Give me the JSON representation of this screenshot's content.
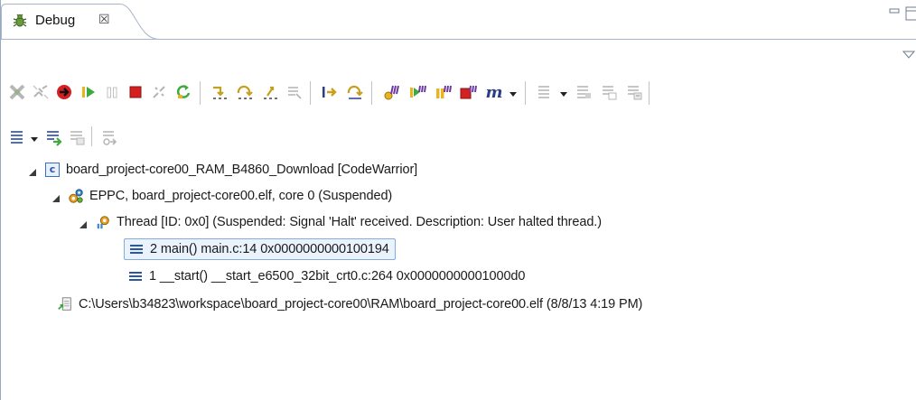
{
  "view": {
    "tab_label": "Debug",
    "tab_close_glyph": "☒",
    "tab_icon": "bug-icon"
  },
  "toolbar1": {
    "buttons": [
      "remove-all-terminated-icon",
      "connect-icon",
      "debug-step-into-icon",
      "resume-icon",
      "suspend-icon",
      "terminate-icon",
      "disconnect-icon",
      "restart-icon",
      "step-into-icon",
      "step-over-icon",
      "step-return-icon",
      "drop-to-frame-icon",
      "instruction-stepping-icon",
      "use-step-filters-icon",
      "multicore-group-icon",
      "multicore-resume-icon",
      "multicore-suspend-icon",
      "multicore-terminate-icon",
      "multicore-m-icon",
      "dropdown-arrow-icon",
      "collapse-all-icon",
      "dropdown-arrow-icon",
      "source-lookup-icon",
      "disassembly-icon",
      "memory-icon"
    ],
    "m_glyph": "m"
  },
  "toolbar2": {
    "buttons": [
      "layout-icon",
      "dropdown-arrow-icon",
      "move-icon",
      "copy-stack-icon",
      "filter-icon"
    ]
  },
  "tree": {
    "launch": {
      "label": "board_project-core00_RAM_B4860_Download [CodeWarrior]",
      "icon_glyph": "c"
    },
    "process": {
      "label": "EPPC, board_project-core00.elf, core 0 (Suspended)"
    },
    "thread": {
      "label": "Thread [ID: 0x0] (Suspended: Signal 'Halt' received. Description: User halted thread.)"
    },
    "frames": [
      {
        "label": "2 main() main.c:14 0x0000000000100194"
      },
      {
        "label": "1 __start() __start_e6500_32bit_crt0.c:264 0x00000000001000d0"
      }
    ],
    "binary": {
      "label": "C:\\Users\\b34823\\workspace\\board_project-core00\\RAM\\board_project-core00.elf (8/8/13 4:19 PM)"
    }
  },
  "colors": {
    "selection_border": "#84acdd",
    "selection_fill": "#eaf2fc",
    "terminate_red": "#d42020",
    "resume_green": "#3ea93e"
  }
}
